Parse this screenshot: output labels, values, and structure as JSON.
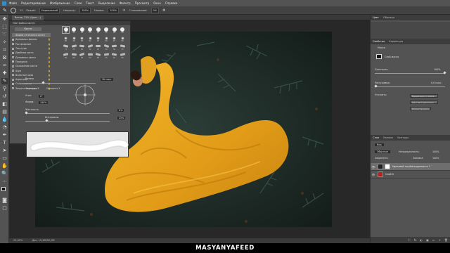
{
  "menubar": {
    "items": [
      "Файл",
      "Редактирование",
      "Изображение",
      "Слои",
      "Текст",
      "Выделение",
      "Фильтр",
      "Просмотр",
      "Окно",
      "Справка"
    ]
  },
  "options": {
    "size": "13",
    "mode_label": "Режим:",
    "mode_value": "Нормальный",
    "opacity_label": "Непрозр.:",
    "opacity_value": "100%",
    "flow_label": "Нажим:",
    "flow_value": "100%",
    "smoothing_label": "Сглаживание:",
    "smoothing_value": "0%"
  },
  "document": {
    "tab": "Ветви, 25% (Цвет…)"
  },
  "status": {
    "zoom": "25,05%",
    "doc": "Док: 19,4M/50,5M"
  },
  "brush_panel": {
    "title": "Настройки кисти",
    "brushes_button": "Кисти",
    "items": [
      {
        "label": "Форма отпечатка кисти",
        "checked": false,
        "selected": true
      },
      {
        "label": "Динамика формы",
        "checked": true
      },
      {
        "label": "Рассеивание",
        "checked": false
      },
      {
        "label": "Текстура",
        "checked": false
      },
      {
        "label": "Двойная кисть",
        "checked": false
      },
      {
        "label": "Динамика цвета",
        "checked": false
      },
      {
        "label": "Передача",
        "checked": true
      },
      {
        "label": "Положение кисти",
        "checked": false
      },
      {
        "label": "Шум",
        "checked": false
      },
      {
        "label": "Влажные края",
        "checked": false
      },
      {
        "label": "Аэрограф",
        "checked": false
      },
      {
        "label": "Сглаживание",
        "checked": true
      },
      {
        "label": "Защита текстуры",
        "checked": false
      }
    ],
    "tip_sizes": [
      "30",
      "30",
      "30",
      "25",
      "25",
      "25",
      "36",
      "25",
      "36",
      "36",
      "36",
      "32",
      "25",
      "50",
      "25",
      "50",
      "71",
      "25",
      "50",
      "71",
      "25",
      "50",
      "36",
      "25",
      "50",
      "60",
      "25",
      "50",
      "60",
      "25",
      "50",
      "40"
    ],
    "size_label": "Размер",
    "size_value": "30 пикс.",
    "flipx_label": "Отразить X",
    "flipy_label": "Отразить Y",
    "angle_label": "Угол:",
    "angle_value": "0°",
    "roundness_label": "Форма:",
    "roundness_value": "100%",
    "hardness_label": "Жесткость",
    "hardness_value": "0%",
    "spacing_label": "Интервалы",
    "spacing_value": "25%",
    "size_level": 0.25,
    "hardness_level": 0.0,
    "spacing_level": 0.25
  },
  "right_dock": {
    "top_tabs": [
      "Цвет",
      "Образцы"
    ],
    "props_tabs": [
      "Свойства",
      "Коррекция"
    ],
    "props_title": "Маски",
    "layer_mask_label": "Слой-маска",
    "density_label": "Плотность:",
    "density_value": "100%",
    "feather_label": "Растушевка:",
    "feather_value": "0,0 пикс.",
    "refine_label": "Уточнить:",
    "buttons": [
      "Выделение и маска...",
      "Цветовой диапазон...",
      "Инвертировать"
    ],
    "layers_tabs": [
      "Слои",
      "Каналы",
      "Контуры"
    ],
    "search_label": "Вид",
    "blend_value": "Обычные",
    "opacity_label": "Непрозрачность:",
    "opacity_value": "100%",
    "lock_label": "Закрепить:",
    "fill_label": "Заливка:",
    "fill_value": "100%",
    "layers": [
      {
        "name": "Цветовой тон/Насыщенность 1",
        "selected": true
      },
      {
        "name": "Слой 0",
        "selected": false
      }
    ],
    "layer_actions": [
      "ⓕ",
      "fx",
      "◐",
      "▣",
      "▭",
      "+",
      "🗑"
    ]
  },
  "watermark": "MASYANYAFEED",
  "colors": {
    "dress": "#e8a420",
    "foliage": "#1f2e2a",
    "accent": "#2a8fd6",
    "layer_thumb": "#b02222"
  }
}
